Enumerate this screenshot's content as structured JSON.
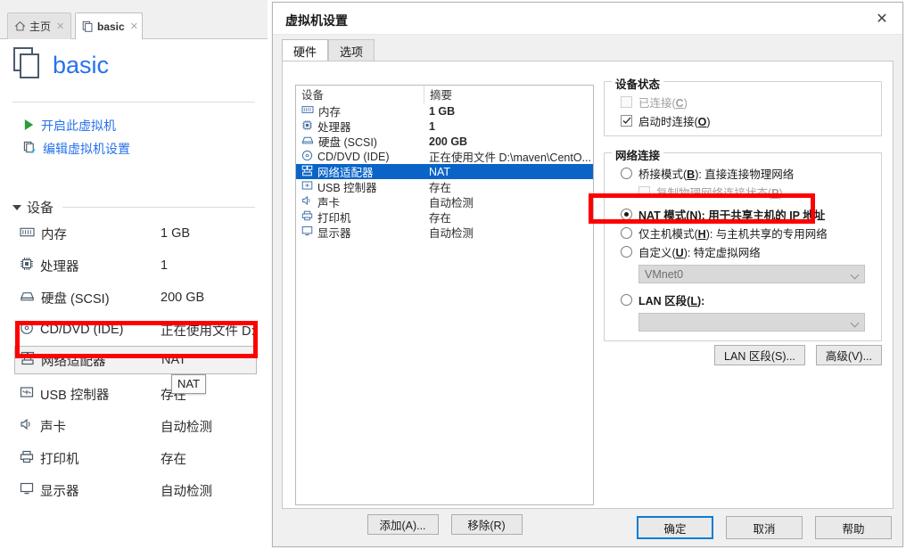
{
  "app": {
    "tabs": [
      {
        "label": "主页",
        "icon": "home-icon",
        "close": "✕",
        "active": false
      },
      {
        "label": "basic",
        "icon": "vm-icon",
        "close": "✕",
        "active": true
      }
    ],
    "vm_title": "basic",
    "actions": [
      {
        "label": "开启此虚拟机",
        "icon": "play-icon"
      },
      {
        "label": "编辑虚拟机设置",
        "icon": "settings-icon"
      }
    ],
    "devices_section_label": "设备",
    "devices": [
      {
        "icon": "memory-icon",
        "name": "内存",
        "value": "1 GB"
      },
      {
        "icon": "cpu-icon",
        "name": "处理器",
        "value": "1"
      },
      {
        "icon": "harddisk-icon",
        "name": "硬盘 (SCSI)",
        "value": "200 GB"
      },
      {
        "icon": "cddvd-icon",
        "name": "CD/DVD (IDE)",
        "value": "正在使用文件 D:"
      },
      {
        "icon": "network-icon",
        "name": "网络适配器",
        "value": "NAT",
        "selected": true
      },
      {
        "icon": "usb-icon",
        "name": "USB 控制器",
        "value": "存在"
      },
      {
        "icon": "sound-icon",
        "name": "声卡",
        "value": "自动检测"
      },
      {
        "icon": "printer-icon",
        "name": "打印机",
        "value": "存在"
      },
      {
        "icon": "display-icon",
        "name": "显示器",
        "value": "自动检测"
      }
    ],
    "tooltip": "NAT"
  },
  "dialog": {
    "title": "虚拟机设置",
    "close_glyph": "✕",
    "tabs": [
      {
        "label": "硬件",
        "active": true
      },
      {
        "label": "选项",
        "active": false
      }
    ],
    "table": {
      "headers": [
        "设备",
        "摘要"
      ],
      "rows": [
        {
          "icon": "memory-icon",
          "device": "内存",
          "summary": "1 GB",
          "bold": true,
          "selected": false
        },
        {
          "icon": "cpu-icon",
          "device": "处理器",
          "summary": "1",
          "bold": true,
          "selected": false
        },
        {
          "icon": "harddisk-icon",
          "device": "硬盘 (SCSI)",
          "summary": "200 GB",
          "bold": true,
          "selected": false
        },
        {
          "icon": "cddvd-icon",
          "device": "CD/DVD (IDE)",
          "summary": "正在使用文件 D:\\maven\\CentO...",
          "bold": false,
          "selected": false
        },
        {
          "icon": "network-icon",
          "device": "网络适配器",
          "summary": "NAT",
          "bold": false,
          "selected": true
        },
        {
          "icon": "usb-icon",
          "device": "USB 控制器",
          "summary": "存在",
          "bold": false,
          "selected": false
        },
        {
          "icon": "sound-icon",
          "device": "声卡",
          "summary": "自动检测",
          "bold": false,
          "selected": false
        },
        {
          "icon": "printer-icon",
          "device": "打印机",
          "summary": "存在",
          "bold": false,
          "selected": false
        },
        {
          "icon": "display-icon",
          "device": "显示器",
          "summary": "自动检测",
          "bold": false,
          "selected": false
        }
      ]
    },
    "add_button": "添加(A)...",
    "remove_button": "移除(R)",
    "device_status": {
      "legend": "设备状态",
      "connected": {
        "label_pre": "已连接(",
        "key": "C",
        "label_post": ")",
        "checked": false,
        "disabled": true
      },
      "connect_at_power_on": {
        "label_pre": "启动时连接(",
        "key": "O",
        "label_post": ")",
        "checked": true,
        "disabled": false
      }
    },
    "network_connection": {
      "legend": "网络连接",
      "options": [
        {
          "label_pre": "桥接模式(",
          "key": "B",
          "label_post": "): 直接连接物理网络",
          "selected": false
        },
        {
          "label_pre": "NAT 模式(",
          "key": "N",
          "label_post": "): 用于共享主机的 IP 地址",
          "selected": true,
          "highlighted": true
        },
        {
          "label_pre": "仅主机模式(",
          "key": "H",
          "label_post": "): 与主机共享的专用网络",
          "selected": false
        },
        {
          "label_pre": "自定义(",
          "key": "U",
          "label_post": "): 特定虚拟网络",
          "selected": false
        },
        {
          "label_pre": "LAN 区段(",
          "key": "L",
          "label_post": "):",
          "selected": false
        }
      ],
      "replicate_state": {
        "label_pre": "复制物理网络连接状态(",
        "key": "P",
        "label_post": ")",
        "checked": false,
        "disabled": true
      },
      "custom_combo_value": "VMnet0",
      "lan_combo_value": "",
      "lan_segments_button": "LAN 区段(S)...",
      "advanced_button": "高级(V)..."
    },
    "footer": {
      "ok": "确定",
      "cancel": "取消",
      "help": "帮助"
    }
  },
  "colors": {
    "accent_blue": "#2672ec",
    "selection_blue": "#0a64c8",
    "highlight_red": "#ff0000",
    "focus_border": "#0a7cd4"
  }
}
